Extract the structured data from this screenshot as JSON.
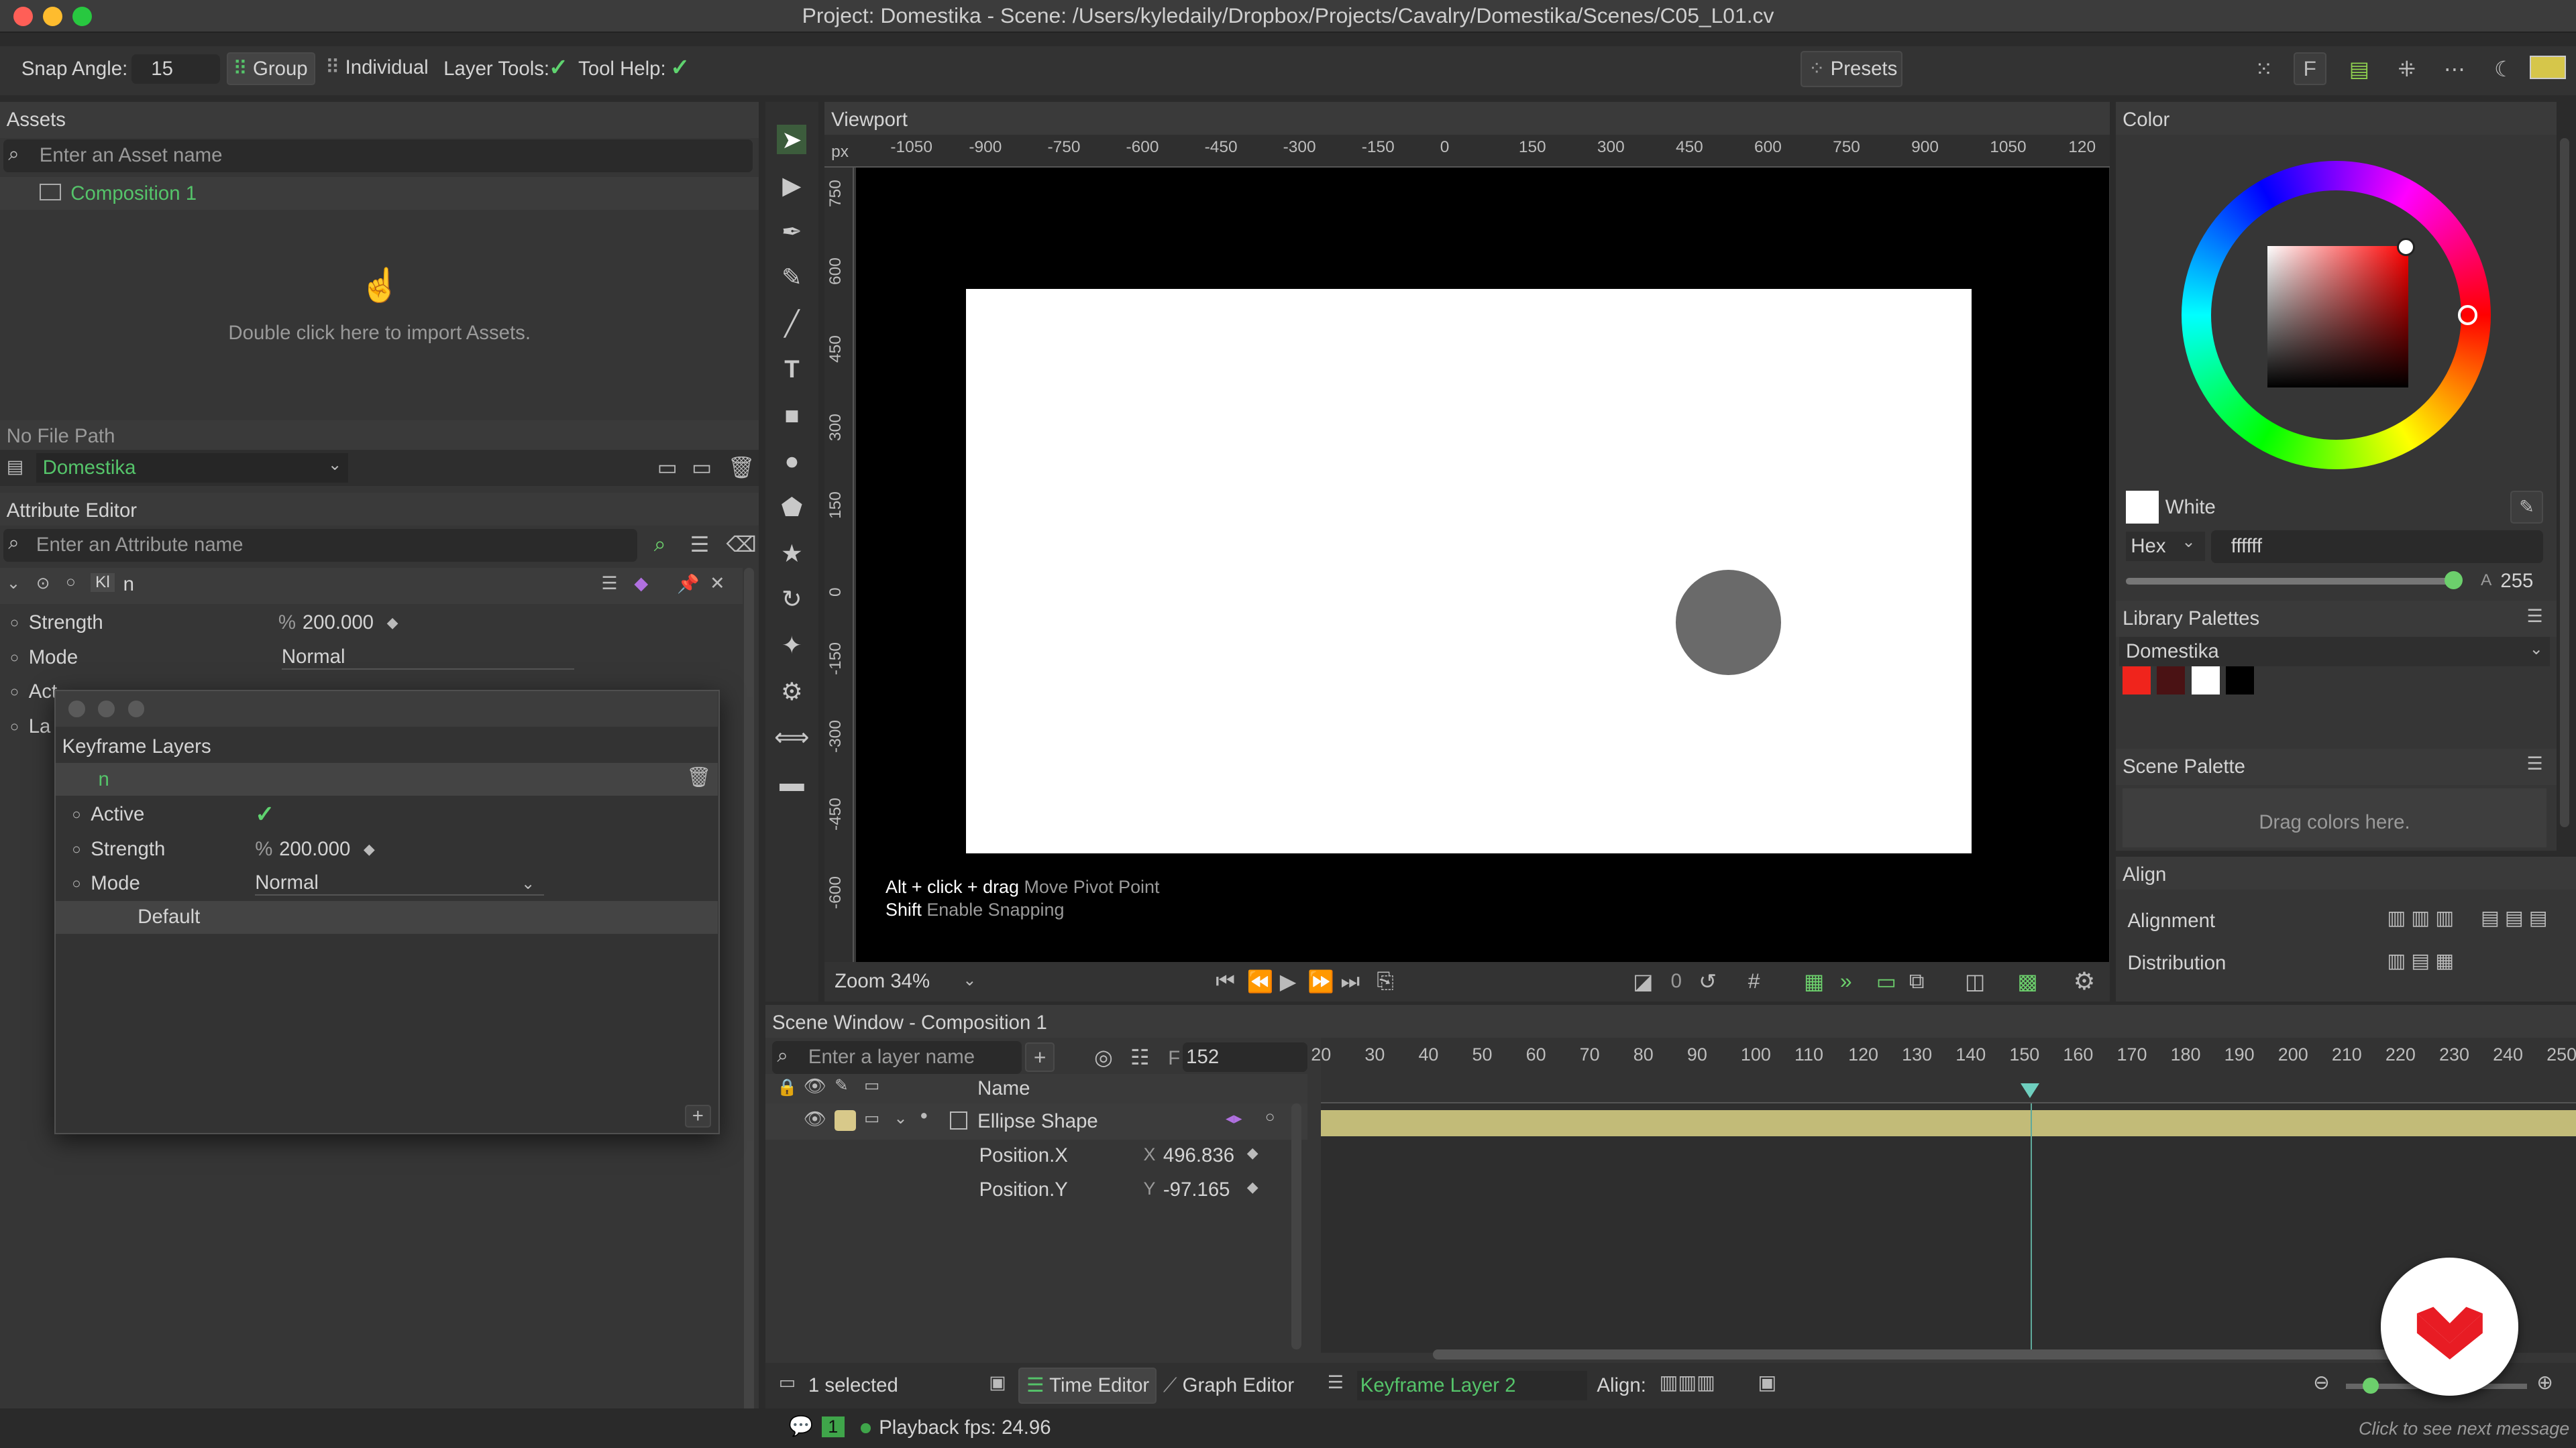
{
  "window": {
    "title": "Project: Domestika - Scene: /Users/kyledaily/Dropbox/Projects/Cavalry/Domestika/Scenes/C05_L01.cv"
  },
  "toolbar": {
    "snap_angle_label": "Snap Angle:",
    "snap_angle_value": "15",
    "group": "Group",
    "individual": "Individual",
    "layer_tools": "Layer Tools:",
    "tool_help": "Tool Help:",
    "presets": "Presets"
  },
  "assets": {
    "title": "Assets",
    "search_placeholder": "Enter an Asset name",
    "item": "Composition 1",
    "import_hint": "Double click here to import Assets.",
    "file_path": "No File Path",
    "project": "Domestika"
  },
  "attribute_editor": {
    "title": "Attribute Editor",
    "search_placeholder": "Enter an Attribute name",
    "layer_badge": "Kl",
    "layer_name": "n",
    "rows": [
      {
        "label": "Strength",
        "prefix": "%",
        "value": "200.000"
      },
      {
        "label": "Mode",
        "value": "Normal"
      },
      {
        "label": "Act"
      },
      {
        "label": "La"
      }
    ]
  },
  "keyframe_popup": {
    "title": "Keyframe Layers",
    "item": "n",
    "active_label": "Active",
    "strength_label": "Strength",
    "strength_prefix": "%",
    "strength_value": "200.000",
    "mode_label": "Mode",
    "mode_value": "Normal",
    "default_label": "Default"
  },
  "viewport": {
    "title": "Viewport",
    "unit": "px",
    "x_ticks": [
      "-1050",
      "-900",
      "-750",
      "-600",
      "-450",
      "-300",
      "-150",
      "0",
      "150",
      "300",
      "450",
      "600",
      "750",
      "900",
      "1050",
      "120"
    ],
    "y_ticks": [
      "750",
      "600",
      "450",
      "300",
      "150",
      "0",
      "-150",
      "-300",
      "-450",
      "-600"
    ],
    "help1_key": "Alt + click + drag",
    "help1_text": "Move Pivot Point",
    "help2_key": "Shift",
    "help2_text": "Enable Snapping",
    "zoom_label": "Zoom",
    "zoom_value": "34%",
    "frame": "0"
  },
  "color": {
    "title": "Color",
    "swatch_name": "White",
    "format": "Hex",
    "hex": "ffffff",
    "alpha_label": "A",
    "alpha": "255",
    "library_title": "Library Palettes",
    "library_name": "Domestika",
    "library_colors": [
      "#f0241c",
      "#4a1214",
      "#ffffff",
      "#000000"
    ],
    "scene_palette_title": "Scene Palette",
    "scene_palette_hint": "Drag colors here."
  },
  "align": {
    "title": "Align",
    "alignment": "Alignment",
    "distribution": "Distribution"
  },
  "scene": {
    "title": "Scene Window - Composition 1",
    "search_placeholder": "Enter a layer name",
    "frame_prefix": "F",
    "frame": "152",
    "name_col": "Name",
    "layer": "Ellipse Shape",
    "props": [
      {
        "name": "Position.X",
        "axis": "X",
        "value": "496.836"
      },
      {
        "name": "Position.Y",
        "axis": "Y",
        "value": "-97.165"
      }
    ],
    "ticks": [
      "20",
      "30",
      "40",
      "50",
      "60",
      "70",
      "80",
      "90",
      "100",
      "110",
      "120",
      "130",
      "140",
      "150",
      "160",
      "170",
      "180",
      "190",
      "200",
      "210",
      "220",
      "230",
      "240",
      "250"
    ],
    "selected": "1 selected",
    "time_editor": "Time Editor",
    "graph_editor": "Graph Editor",
    "keyframe_layer": "Keyframe Layer 2",
    "align_label": "Align:"
  },
  "status": {
    "badge": "1",
    "fps": "Playback fps: 24.96",
    "message": "Click to see next message"
  }
}
